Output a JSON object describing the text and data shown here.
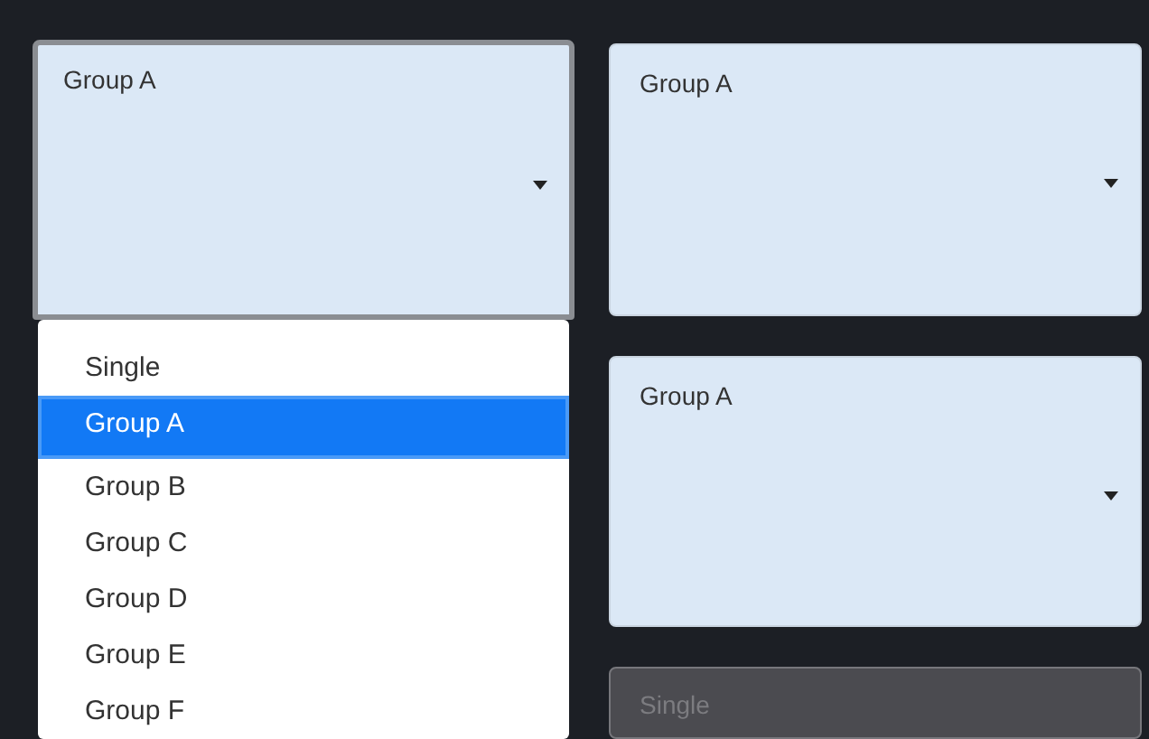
{
  "selects": [
    {
      "value": "Group A",
      "focused": true,
      "disabled": false,
      "open": true,
      "options": [
        {
          "label": "Single",
          "selected": false
        },
        {
          "label": "Group A",
          "selected": true
        },
        {
          "label": "Group B",
          "selected": false
        },
        {
          "label": "Group C",
          "selected": false
        },
        {
          "label": "Group D",
          "selected": false
        },
        {
          "label": "Group E",
          "selected": false
        },
        {
          "label": "Group F",
          "selected": false
        }
      ]
    },
    {
      "value": "Group A",
      "focused": false,
      "disabled": false
    },
    {
      "value": "Group A",
      "focused": false,
      "disabled": false
    },
    {
      "value": "Single",
      "focused": false,
      "disabled": true
    }
  ]
}
